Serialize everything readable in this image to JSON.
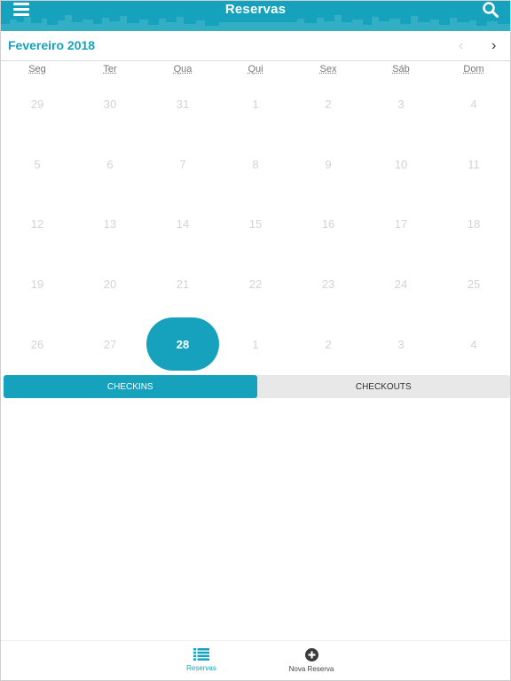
{
  "header": {
    "title": "Reservas",
    "color": "#16a2bc",
    "menu_icon": "hamburger-menu-icon",
    "search_icon": "search-icon"
  },
  "calendar": {
    "month_title": "Fevereiro 2018",
    "prev_label": "‹",
    "next_label": "›",
    "weekdays": [
      "Seg",
      "Ter",
      "Qua",
      "Qui",
      "Sex",
      "Sáb",
      "Dom"
    ],
    "days": [
      "29",
      "30",
      "31",
      "1",
      "2",
      "3",
      "4",
      "5",
      "6",
      "7",
      "8",
      "9",
      "10",
      "11",
      "12",
      "13",
      "14",
      "15",
      "16",
      "17",
      "18",
      "19",
      "20",
      "21",
      "22",
      "23",
      "24",
      "25",
      "26",
      "27",
      "28",
      "1",
      "2",
      "3",
      "4"
    ],
    "selected_day": "28"
  },
  "segment": {
    "checkins_label": "CHECKINS",
    "checkouts_label": "CHECKOUTS",
    "active": "CHECKINS"
  },
  "tabbar": {
    "reservas_label": "Reservas",
    "nova_reserva_label": "Nova Reserva",
    "active_color": "#16a2bc"
  }
}
